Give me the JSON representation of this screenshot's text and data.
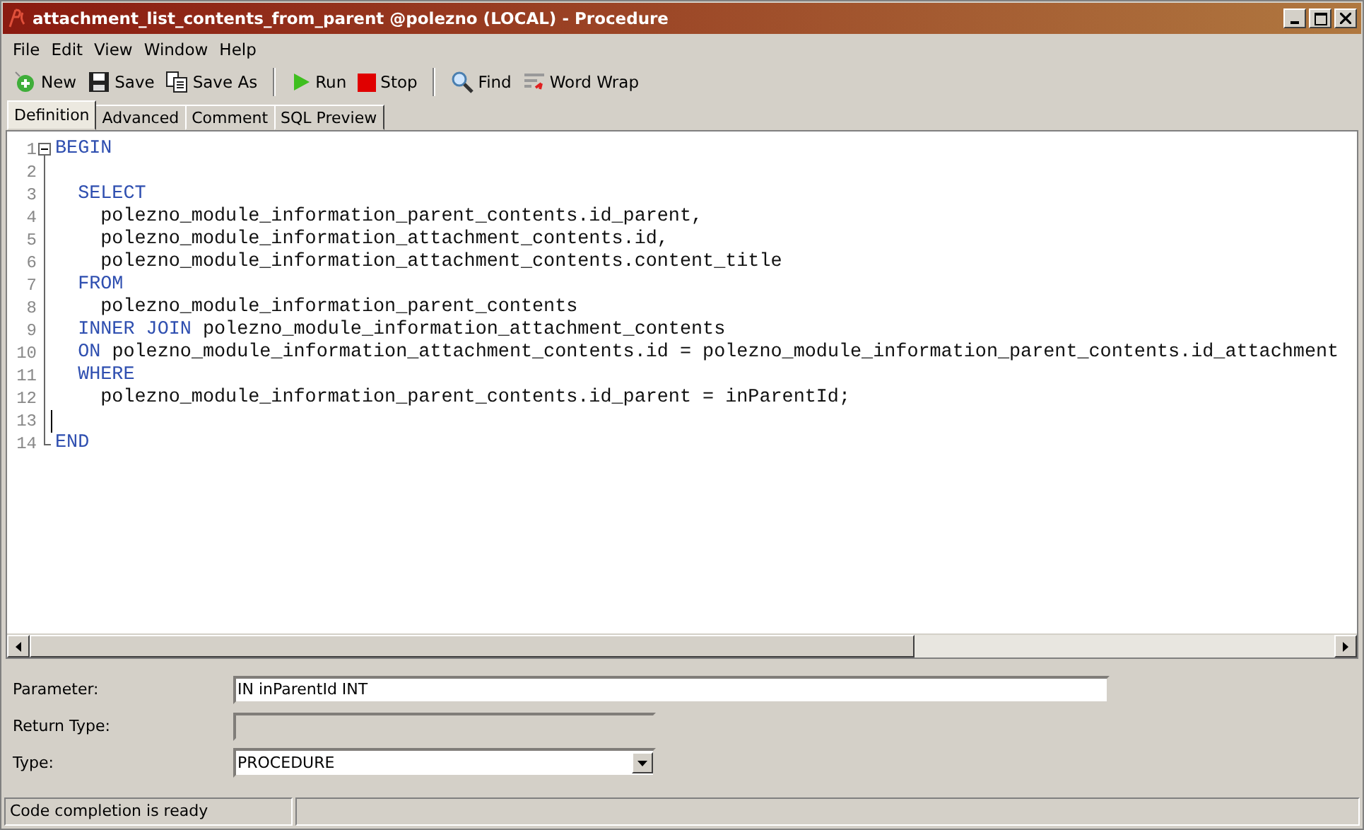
{
  "window": {
    "title": "attachment_list_contents_from_parent @polezno (LOCAL) - Procedure"
  },
  "menu": [
    "File",
    "Edit",
    "View",
    "Window",
    "Help"
  ],
  "toolbar": [
    {
      "kind": "new",
      "label": "New"
    },
    {
      "kind": "save",
      "label": "Save"
    },
    {
      "kind": "saveas",
      "label": "Save As"
    },
    {
      "kind": "run",
      "label": "Run"
    },
    {
      "kind": "stop",
      "label": "Stop"
    },
    {
      "kind": "find",
      "label": "Find"
    },
    {
      "kind": "wrap",
      "label": "Word Wrap"
    }
  ],
  "tabs": [
    {
      "label": "Definition",
      "selected": true
    },
    {
      "label": "Advanced",
      "selected": false
    },
    {
      "label": "Comment",
      "selected": false
    },
    {
      "label": "SQL Preview",
      "selected": false
    }
  ],
  "editor": {
    "lines": [
      {
        "number": "1",
        "fold_start": true,
        "tokens": [
          {
            "kind": "keyword",
            "text": "BEGIN"
          }
        ]
      },
      {
        "number": "2"
      },
      {
        "number": "3",
        "tokens": [
          {
            "kind": "keyword",
            "text": "  SELECT"
          }
        ]
      },
      {
        "number": "4",
        "tokens": [
          {
            "kind": "plain",
            "text": "    polezno_module_information_parent_contents.id_parent,"
          }
        ]
      },
      {
        "number": "5",
        "tokens": [
          {
            "kind": "plain",
            "text": "    polezno_module_information_attachment_contents.id,"
          }
        ]
      },
      {
        "number": "6",
        "tokens": [
          {
            "kind": "plain",
            "text": "    polezno_module_information_attachment_contents.content_title"
          }
        ]
      },
      {
        "number": "7",
        "tokens": [
          {
            "kind": "keyword",
            "text": "  FROM"
          }
        ]
      },
      {
        "number": "8",
        "tokens": [
          {
            "kind": "plain",
            "text": "    polezno_module_information_parent_contents"
          }
        ]
      },
      {
        "number": "9",
        "tokens": [
          {
            "kind": "keyword",
            "text": "  INNER JOIN"
          },
          {
            "kind": "plain",
            "text": " polezno_module_information_attachment_contents"
          }
        ]
      },
      {
        "number": "10",
        "tokens": [
          {
            "kind": "keyword",
            "text": "  ON"
          },
          {
            "kind": "plain",
            "text": " polezno_module_information_attachment_contents.id = polezno_module_information_parent_contents.id_attachment"
          }
        ]
      },
      {
        "number": "11",
        "tokens": [
          {
            "kind": "keyword",
            "text": "  WHERE"
          }
        ]
      },
      {
        "number": "12",
        "tokens": [
          {
            "kind": "plain",
            "text": "    polezno_module_information_parent_contents.id_parent = inParentId;"
          }
        ]
      },
      {
        "number": "13",
        "cursor": true
      },
      {
        "number": "14",
        "fold_end": true,
        "tokens": [
          {
            "kind": "keyword",
            "text": "END"
          }
        ]
      }
    ]
  },
  "form": [
    {
      "kind": "text",
      "label": "Parameter:",
      "value": "IN inParentId INT"
    },
    {
      "kind": "text",
      "label": "Return Type:",
      "disabled": true
    },
    {
      "kind": "select",
      "label": "Type:",
      "value": "PROCEDURE"
    }
  ],
  "status_bar": {
    "text": "Code completion is ready"
  }
}
